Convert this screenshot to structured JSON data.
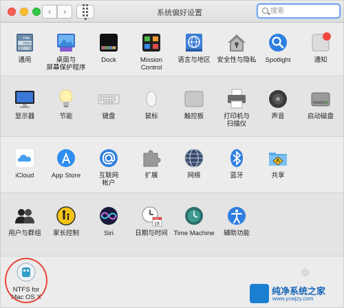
{
  "window": {
    "title": "系统偏好设置",
    "search": {
      "placeholder": "搜索",
      "value": ""
    }
  },
  "toolbar": {
    "back_label": "‹",
    "forward_label": "›"
  },
  "sections": {
    "personal": [
      {
        "label": "通用"
      },
      {
        "label": "桌面与\n屏幕保护程序"
      },
      {
        "label": "Dock"
      },
      {
        "label": "Mission\nControl"
      },
      {
        "label": "语言与地区"
      },
      {
        "label": "安全性与隐私"
      },
      {
        "label": "Spotlight"
      },
      {
        "label": "通知"
      }
    ],
    "hardware": [
      {
        "label": "显示器"
      },
      {
        "label": "节能"
      },
      {
        "label": "键盘"
      },
      {
        "label": "鼠标"
      },
      {
        "label": "触控板"
      },
      {
        "label": "打印机与\n扫描仪"
      },
      {
        "label": "声音"
      },
      {
        "label": "启动磁盘"
      }
    ],
    "internet": [
      {
        "label": "iCloud"
      },
      {
        "label": "App Store"
      },
      {
        "label": "互联网\n帐户"
      },
      {
        "label": "扩展"
      },
      {
        "label": "网络"
      },
      {
        "label": "蓝牙"
      },
      {
        "label": "共享"
      }
    ],
    "system": [
      {
        "label": "用户与群组"
      },
      {
        "label": "家长控制"
      },
      {
        "label": "Siri"
      },
      {
        "label": "日期与时间"
      },
      {
        "label": "Time Machine"
      },
      {
        "label": "辅助功能"
      }
    ],
    "other": [
      {
        "label": "NTFS for\nMac OS X"
      }
    ]
  },
  "icon_texts": {
    "general_file": "File",
    "general_new": "New",
    "general_op": "Op",
    "calendar_month": "JUL",
    "calendar_day": "18"
  },
  "watermark": {
    "name": "纯净系统之家",
    "url": "www.ycwjzy.com"
  },
  "colors": {
    "accent": "#1b84e8",
    "notification_badge": "#f2473f",
    "highlight_ring": "#e8433a"
  }
}
